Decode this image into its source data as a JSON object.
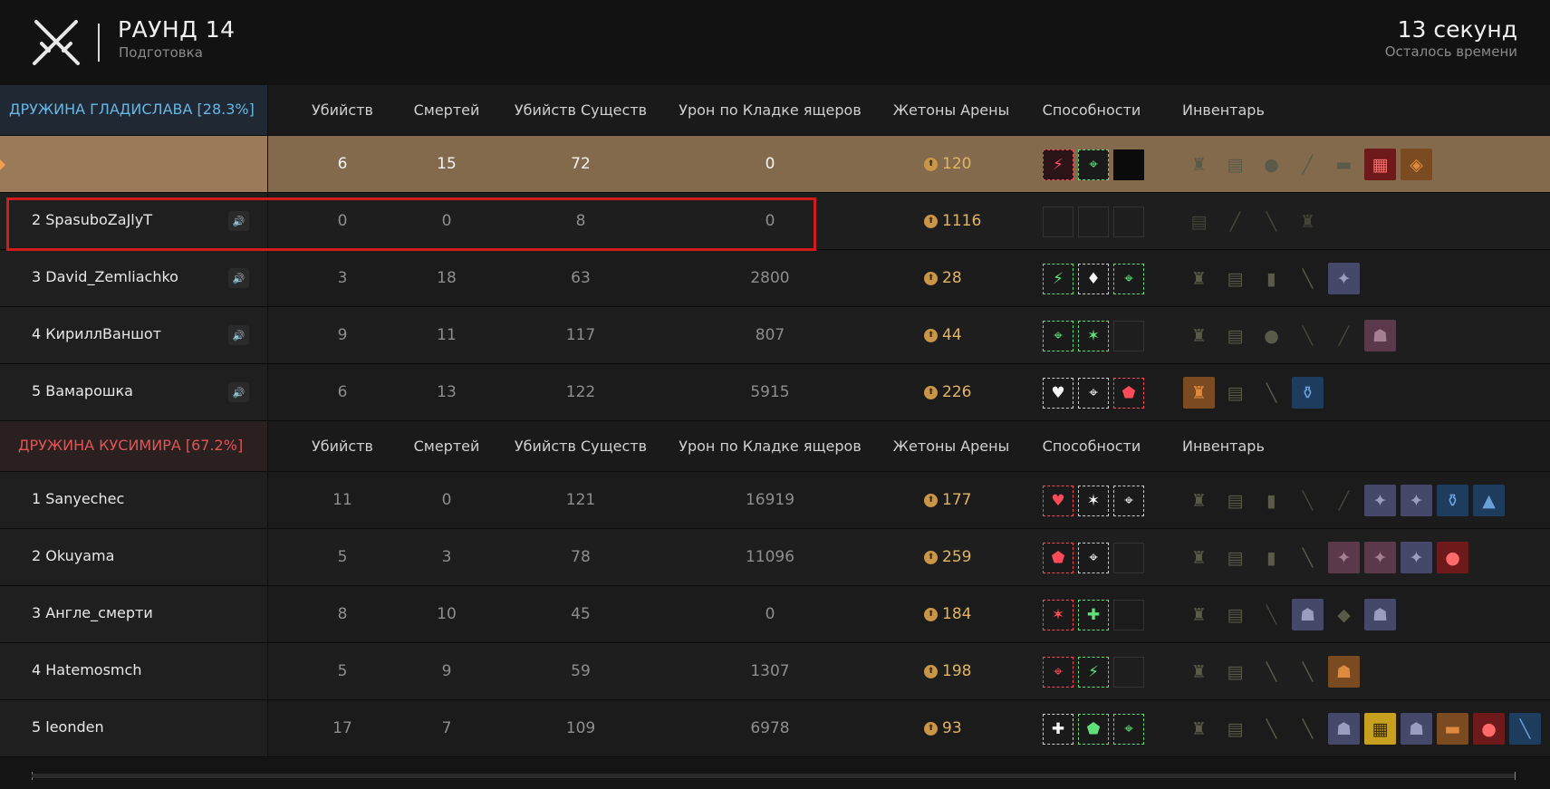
{
  "header": {
    "round_title": "РАУНД 14",
    "round_subtitle": "Подготовка",
    "timer": "13 секунд",
    "timer_subtitle": "Осталось времени"
  },
  "columns": {
    "kills": "Убийств",
    "deaths": "Смертей",
    "creature_kills": "Убийств Существ",
    "damage": "Урон по Кладке ящеров",
    "tokens": "Жетоны Арены",
    "abilities": "Способности",
    "inventory": "Инвентарь"
  },
  "teams": [
    {
      "name": "ДРУЖИНА ГЛАДИСЛАВА [28.3%]",
      "color": "#66b7e6",
      "players": [
        {
          "name": "",
          "kills": "6",
          "deaths": "15",
          "creature_kills": "72",
          "damage": "0",
          "tokens": "120",
          "self": true,
          "abilities": [
            {
              "icon": "⚡",
              "style": "r fillr"
            },
            {
              "icon": "⌖",
              "style": "g"
            },
            {
              "icon": "",
              "style": "dark"
            }
          ],
          "inventory": [
            {
              "icon": "♜",
              "style": ""
            },
            {
              "icon": "▤",
              "style": ""
            },
            {
              "icon": "●",
              "style": ""
            },
            {
              "icon": "╱",
              "style": ""
            },
            {
              "icon": "▬",
              "style": ""
            },
            {
              "icon": "▦",
              "style": "red"
            },
            {
              "icon": "◈",
              "style": "org"
            }
          ]
        },
        {
          "name": "2 SpasuboZaJlyT",
          "kills": "0",
          "deaths": "0",
          "creature_kills": "8",
          "damage": "0",
          "tokens": "1116",
          "abilities": [
            {
              "icon": "",
              "style": "empty"
            },
            {
              "icon": "",
              "style": "empty"
            },
            {
              "icon": "",
              "style": "empty"
            }
          ],
          "inventory": [
            {
              "icon": "▤",
              "style": "dim"
            },
            {
              "icon": "╱",
              "style": "dim"
            },
            {
              "icon": "╲",
              "style": "dim"
            },
            {
              "icon": "♜",
              "style": "dim"
            }
          ]
        },
        {
          "name": "3 David_Zemliachko",
          "kills": "3",
          "deaths": "18",
          "creature_kills": "63",
          "damage": "2800",
          "tokens": "28",
          "abilities": [
            {
              "icon": "⚡",
              "style": "g"
            },
            {
              "icon": "♦",
              "style": "w"
            },
            {
              "icon": "⌖",
              "style": "g"
            }
          ],
          "inventory": [
            {
              "icon": "♜",
              "style": ""
            },
            {
              "icon": "▤",
              "style": ""
            },
            {
              "icon": "▮",
              "style": ""
            },
            {
              "icon": "╲",
              "style": ""
            },
            {
              "icon": "✦",
              "style": "box"
            }
          ]
        },
        {
          "name": "4 КириллВаншот",
          "kills": "9",
          "deaths": "11",
          "creature_kills": "117",
          "damage": "807",
          "tokens": "44",
          "abilities": [
            {
              "icon": "⌖",
              "style": "g"
            },
            {
              "icon": "✶",
              "style": "g"
            },
            {
              "icon": "",
              "style": "empty"
            }
          ],
          "inventory": [
            {
              "icon": "♜",
              "style": ""
            },
            {
              "icon": "▤",
              "style": ""
            },
            {
              "icon": "●",
              "style": ""
            },
            {
              "icon": "╲",
              "style": "dim"
            },
            {
              "icon": "╱",
              "style": "dim"
            },
            {
              "icon": "☗",
              "style": "pink"
            }
          ]
        },
        {
          "name": "5 Вамарошка",
          "kills": "6",
          "deaths": "13",
          "creature_kills": "122",
          "damage": "5915",
          "tokens": "226",
          "abilities": [
            {
              "icon": "♥",
              "style": "w"
            },
            {
              "icon": "⌖",
              "style": "w"
            },
            {
              "icon": "⬟",
              "style": "r"
            }
          ],
          "inventory": [
            {
              "icon": "♜",
              "style": "org"
            },
            {
              "icon": "▤",
              "style": ""
            },
            {
              "icon": "╲",
              "style": ""
            },
            {
              "icon": "⚱",
              "style": "blue"
            }
          ]
        }
      ]
    },
    {
      "name": "ДРУЖИНА КУСИМИРА [67.2%]",
      "color": "#e05555",
      "players": [
        {
          "name": "1 Sanyechec",
          "kills": "11",
          "deaths": "0",
          "creature_kills": "121",
          "damage": "16919",
          "tokens": "177",
          "abilities": [
            {
              "icon": "♥",
              "style": "r"
            },
            {
              "icon": "✶",
              "style": "w"
            },
            {
              "icon": "⌖",
              "style": "w"
            }
          ],
          "inventory": [
            {
              "icon": "♜",
              "style": ""
            },
            {
              "icon": "▤",
              "style": ""
            },
            {
              "icon": "▮",
              "style": ""
            },
            {
              "icon": "╲",
              "style": "dim"
            },
            {
              "icon": "╱",
              "style": "dim"
            },
            {
              "icon": "✦",
              "style": "box"
            },
            {
              "icon": "✦",
              "style": "box"
            },
            {
              "icon": "⚱",
              "style": "blue"
            },
            {
              "icon": "▲",
              "style": "blue"
            }
          ]
        },
        {
          "name": "2 Okuyama",
          "kills": "5",
          "deaths": "3",
          "creature_kills": "78",
          "damage": "11096",
          "tokens": "259",
          "abilities": [
            {
              "icon": "⬟",
              "style": "r"
            },
            {
              "icon": "⌖",
              "style": "w"
            },
            {
              "icon": "",
              "style": "empty"
            }
          ],
          "inventory": [
            {
              "icon": "♜",
              "style": ""
            },
            {
              "icon": "▤",
              "style": ""
            },
            {
              "icon": "▮",
              "style": ""
            },
            {
              "icon": "╲",
              "style": ""
            },
            {
              "icon": "✦",
              "style": "pink"
            },
            {
              "icon": "✦",
              "style": "pink"
            },
            {
              "icon": "✦",
              "style": "box"
            },
            {
              "icon": "●",
              "style": "red"
            }
          ]
        },
        {
          "name": "3 Англе_смерти",
          "kills": "8",
          "deaths": "10",
          "creature_kills": "45",
          "damage": "0",
          "tokens": "184",
          "abilities": [
            {
              "icon": "✶",
              "style": "r"
            },
            {
              "icon": "✚",
              "style": "g"
            },
            {
              "icon": "",
              "style": "empty"
            }
          ],
          "inventory": [
            {
              "icon": "♜",
              "style": ""
            },
            {
              "icon": "▤",
              "style": ""
            },
            {
              "icon": "╲",
              "style": "dim"
            },
            {
              "icon": "☗",
              "style": "box"
            },
            {
              "icon": "◆",
              "style": ""
            },
            {
              "icon": "☗",
              "style": "box"
            }
          ]
        },
        {
          "name": "4 Hatemosmch",
          "kills": "5",
          "deaths": "9",
          "creature_kills": "59",
          "damage": "1307",
          "tokens": "198",
          "abilities": [
            {
              "icon": "⌖",
              "style": "r"
            },
            {
              "icon": "⚡",
              "style": "g"
            },
            {
              "icon": "",
              "style": "empty"
            }
          ],
          "inventory": [
            {
              "icon": "♜",
              "style": ""
            },
            {
              "icon": "▤",
              "style": ""
            },
            {
              "icon": "╲",
              "style": ""
            },
            {
              "icon": "╲",
              "style": ""
            },
            {
              "icon": "☗",
              "style": "org"
            }
          ]
        },
        {
          "name": "5 leonden",
          "kills": "17",
          "deaths": "7",
          "creature_kills": "109",
          "damage": "6978",
          "tokens": "93",
          "abilities": [
            {
              "icon": "✚",
              "style": "w"
            },
            {
              "icon": "⬟",
              "style": "g"
            },
            {
              "icon": "⌖",
              "style": "g"
            }
          ],
          "inventory": [
            {
              "icon": "♜",
              "style": ""
            },
            {
              "icon": "▤",
              "style": ""
            },
            {
              "icon": "╲",
              "style": ""
            },
            {
              "icon": "╲",
              "style": ""
            },
            {
              "icon": "☗",
              "style": "box"
            },
            {
              "icon": "▦",
              "style": "gold"
            },
            {
              "icon": "☗",
              "style": "box"
            },
            {
              "icon": "▬",
              "style": "org"
            },
            {
              "icon": "●",
              "style": "red"
            },
            {
              "icon": "╲",
              "style": "blue"
            }
          ]
        }
      ]
    }
  ]
}
